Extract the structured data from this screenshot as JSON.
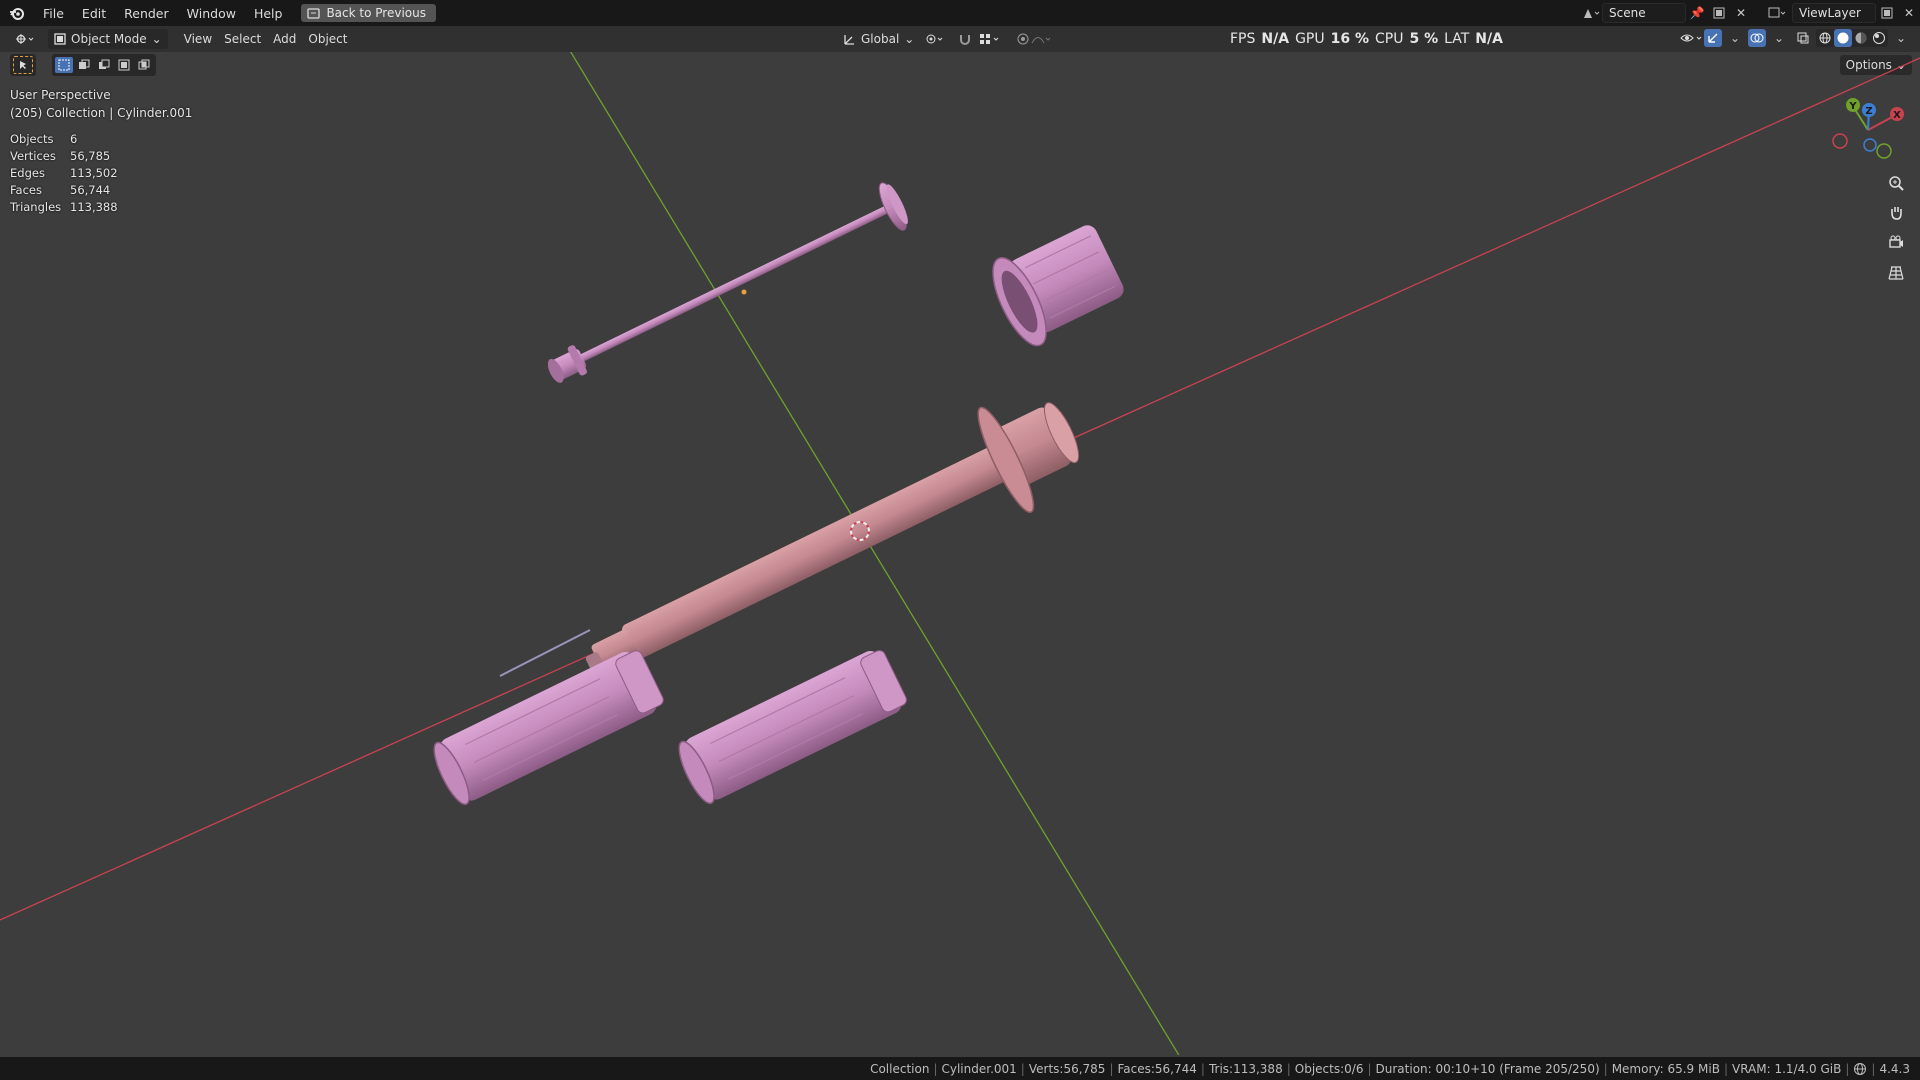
{
  "menu": {
    "items": [
      "File",
      "Edit",
      "Render",
      "Window",
      "Help"
    ],
    "back_label": "Back to Previous"
  },
  "scene_field": "Scene",
  "view_layer_field": "ViewLayer",
  "header": {
    "mode": "Object Mode",
    "menus": [
      "View",
      "Select",
      "Add",
      "Object"
    ],
    "orientation": "Global",
    "options_label": "Options"
  },
  "perf": {
    "fps_label": "FPS",
    "fps_value": "N/A",
    "gpu_label": "GPU",
    "gpu_value": "16 %",
    "cpu_label": "CPU",
    "cpu_value": "5 %",
    "lat_label": "LAT",
    "lat_value": "N/A"
  },
  "viewport": {
    "perspective": "User Perspective",
    "context": "(205) Collection | Cylinder.001"
  },
  "stats": [
    {
      "label": "Objects",
      "value": "6"
    },
    {
      "label": "Vertices",
      "value": "56,785"
    },
    {
      "label": "Edges",
      "value": "113,502"
    },
    {
      "label": "Faces",
      "value": "56,744"
    },
    {
      "label": "Triangles",
      "value": "113,388"
    }
  ],
  "gizmo": {
    "x": "X",
    "y": "Y",
    "z": "Z"
  },
  "status": {
    "collection": "Collection",
    "object": "Cylinder.001",
    "verts": "Verts:56,785",
    "faces": "Faces:56,744",
    "tris": "Tris:113,388",
    "objects": "Objects:0/6",
    "duration": "Duration: 00:10+10 (Frame 205/250)",
    "memory": "Memory: 65.9 MiB",
    "vram": "VRAM: 1.1/4.0 GiB",
    "version": "4.4.3"
  },
  "colors": {
    "accent": "#4772b3",
    "x_axis": "#c8434f",
    "y_axis": "#6fa12b",
    "syringe_body": "#c98b94",
    "syringe_parts": "#c98ac0"
  }
}
